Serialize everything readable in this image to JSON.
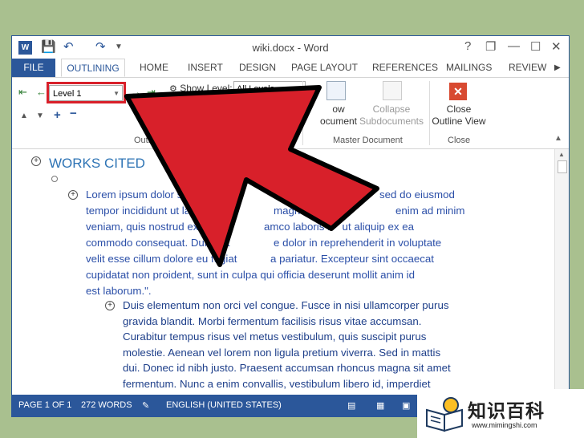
{
  "window": {
    "title": "wiki.docx - Word",
    "controls": [
      "?",
      "❐",
      "—",
      "☐",
      "✕"
    ]
  },
  "ribbon_tabs": [
    "FILE",
    "OUTLINING",
    "HOME",
    "INSERT",
    "DESIGN",
    "PAGE LAYOUT",
    "REFERENCES",
    "MAILINGS",
    "REVIEW"
  ],
  "outline_tools": {
    "level_value": "Level 1",
    "show_level_label": "Show Level:",
    "show_level_value": "All Levels",
    "group_label": "Outli"
  },
  "master_document": {
    "show_label_1": "ow",
    "show_label_2": "ocument",
    "collapse_label_1": "Collapse",
    "collapse_label_2": "Subdocuments",
    "group_label": "Master Document"
  },
  "close_group": {
    "label_1": "Close",
    "label_2": "Outline View",
    "group_label": "Close"
  },
  "document": {
    "heading": "WORKS CITED",
    "para1_lines": [
      "Lorem ipsum dolor sit",
      "tempor incididunt ut lab",
      "veniam, quis nostrud exerci",
      "commodo consequat. Duis aut",
      "velit esse cillum dolore eu fugiat",
      "cupidatat non proident, sunt in culpa qui officia deserunt mollit anim id",
      "est laborum.\"."
    ],
    "para1_right": [
      "sed do eiusmod",
      "enim ad minim",
      "amco laboris n   ut aliquip ex ea",
      "e dolor in reprehenderit in voluptate",
      "a pariatur. Excepteur sint occaecat"
    ],
    "para1_mid": [
      "magn"
    ],
    "para2_lines": [
      "Duis elementum non orci vel congue. Fusce in nisi ullamcorper purus",
      "gravida blandit. Morbi fermentum facilisis risus vitae accumsan.",
      "Curabitur tempus risus vel metus vestibulum, quis suscipit purus",
      "molestie. Aenean vel lorem non ligula pretium viverra. Sed in mattis",
      "dui. Donec id nibh justo. Praesent accumsan rhoncus magna sit amet",
      "fermentum. Nunc a enim convallis, vestibulum libero id, imperdiet"
    ]
  },
  "status_bar": {
    "page": "PAGE 1 OF 1",
    "words": "272 WORDS",
    "language": "ENGLISH (UNITED STATES)"
  },
  "watermark": {
    "title": "知识百科",
    "url": "www.mimingshi.com"
  },
  "annotation": {
    "arrow_color": "#d8202a"
  }
}
